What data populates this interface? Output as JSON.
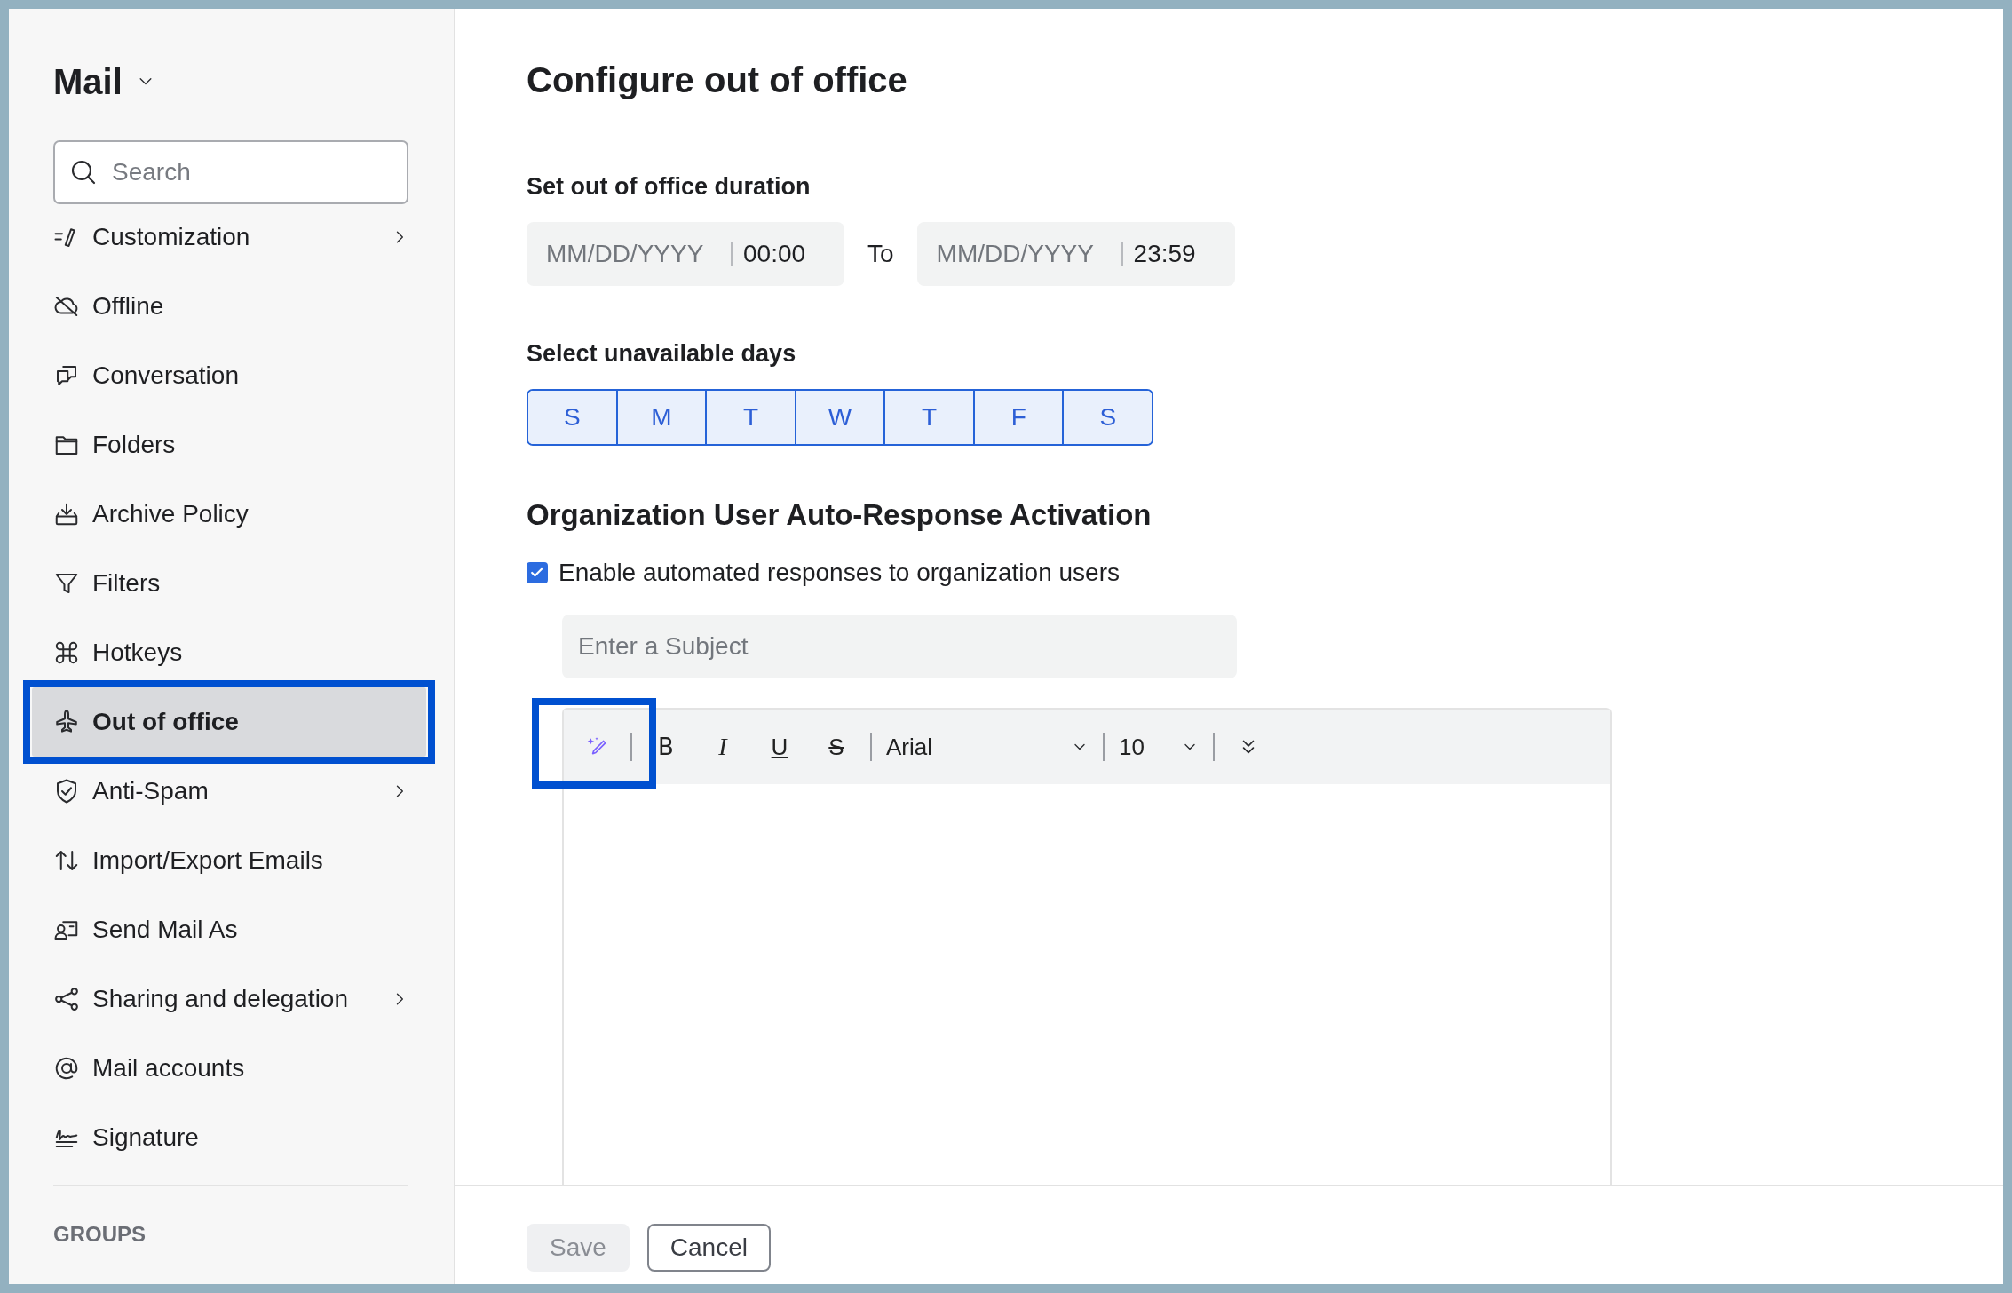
{
  "sidebar": {
    "title": "Mail",
    "search": {
      "placeholder": "Search"
    },
    "items": [
      {
        "label": "Customization",
        "submenu": true,
        "selected": false,
        "highlighted": false
      },
      {
        "label": "Offline",
        "submenu": false,
        "selected": false,
        "highlighted": false
      },
      {
        "label": "Conversation",
        "submenu": false,
        "selected": false,
        "highlighted": false
      },
      {
        "label": "Folders",
        "submenu": false,
        "selected": false,
        "highlighted": false
      },
      {
        "label": "Archive Policy",
        "submenu": false,
        "selected": false,
        "highlighted": false
      },
      {
        "label": "Filters",
        "submenu": false,
        "selected": false,
        "highlighted": false
      },
      {
        "label": "Hotkeys",
        "submenu": false,
        "selected": false,
        "highlighted": false
      },
      {
        "label": "Out of office",
        "submenu": false,
        "selected": true,
        "highlighted": true
      },
      {
        "label": "Anti-Spam",
        "submenu": true,
        "selected": false,
        "highlighted": false
      },
      {
        "label": "Import/Export Emails",
        "submenu": false,
        "selected": false,
        "highlighted": false
      },
      {
        "label": "Send Mail As",
        "submenu": false,
        "selected": false,
        "highlighted": false
      },
      {
        "label": "Sharing and delegation",
        "submenu": true,
        "selected": false,
        "highlighted": false
      },
      {
        "label": "Mail accounts",
        "submenu": false,
        "selected": false,
        "highlighted": false
      },
      {
        "label": "Signature",
        "submenu": false,
        "selected": false,
        "highlighted": false
      }
    ],
    "section": "GROUPS"
  },
  "main": {
    "title": "Configure out of office",
    "duration": {
      "label": "Set out of office duration",
      "separator": "To",
      "fields": [
        {
          "placeholder": "MM/DD/YYYY",
          "time": "00:00"
        },
        {
          "placeholder": "MM/DD/YYYY",
          "time": "23:59"
        }
      ]
    },
    "days": {
      "label": "Select unavailable days",
      "items": [
        {
          "label": "S",
          "selected": true
        },
        {
          "label": "M",
          "selected": true
        },
        {
          "label": "T",
          "selected": true
        },
        {
          "label": "W",
          "selected": true
        },
        {
          "label": "T",
          "selected": true
        },
        {
          "label": "F",
          "selected": true
        },
        {
          "label": "S",
          "selected": true
        }
      ]
    },
    "auto_response": {
      "heading": "Organization User Auto-Response Activation",
      "checkbox": {
        "label": "Enable automated responses to organization users",
        "checked": true
      },
      "subject": {
        "placeholder": "Enter a Subject"
      },
      "toolbar": [
        {
          "kind": "ai",
          "highlighted": true
        },
        {
          "kind": "separator"
        },
        {
          "kind": "bold",
          "label": "B"
        },
        {
          "kind": "italic",
          "label": "I"
        },
        {
          "kind": "underline",
          "label": "U"
        },
        {
          "kind": "strike",
          "label": "S"
        },
        {
          "kind": "separator"
        },
        {
          "kind": "font",
          "value": "Arial"
        },
        {
          "kind": "separator"
        },
        {
          "kind": "size",
          "value": "10"
        },
        {
          "kind": "separator"
        },
        {
          "kind": "more"
        }
      ]
    }
  },
  "footer": {
    "buttons": [
      {
        "label": "Save",
        "disabled": true
      },
      {
        "label": "Cancel",
        "disabled": false
      }
    ]
  }
}
